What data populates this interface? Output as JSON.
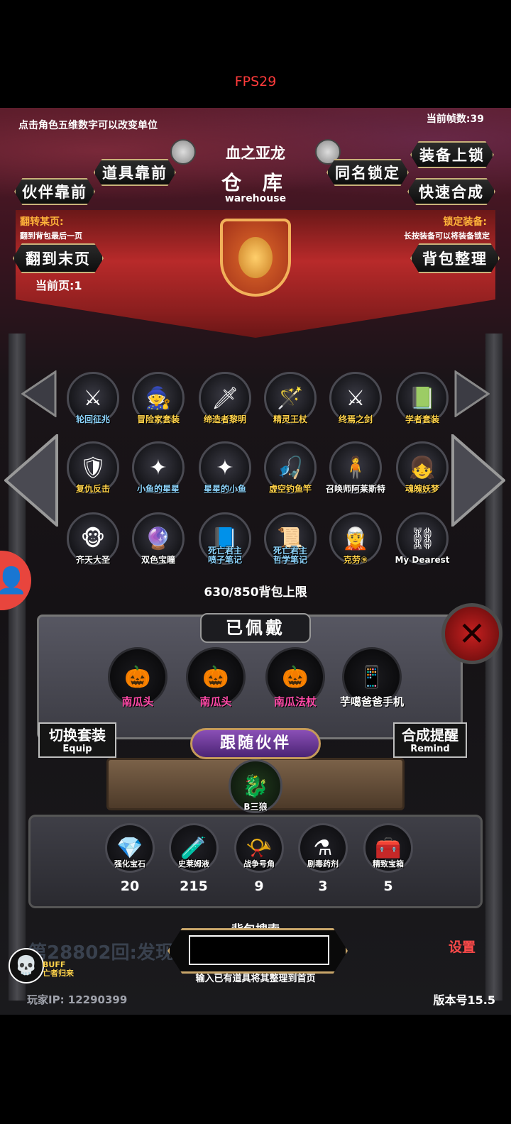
{
  "fps": "FPS29",
  "hud": {
    "hint": "点击角色五维数字可以改变单位",
    "frames": "当前帧数:39"
  },
  "header": {
    "title": "血之亚龙",
    "main": "仓 库",
    "sub": "warehouse"
  },
  "buttons": {
    "items_front": "道具靠前",
    "partner_front": "伙伴靠前",
    "same_lock": "同名锁定",
    "equip_lock": "装备上锁",
    "quick_merge": "快速合成",
    "last_page": "翻到末页",
    "bag_sort": "背包整理",
    "switch_set": "切换套装",
    "switch_set_en": "Equip",
    "merge_remind": "合成提醒",
    "merge_remind_en": "Remind",
    "follow_partner": "跟随伙伴"
  },
  "info": {
    "flip_title": "翻转某页:",
    "flip_desc": "翻到背包最后一页",
    "lock_title": "锁定装备:",
    "lock_desc": "长按装备可以将装备锁定",
    "current_page": "当前页:1"
  },
  "inventory": {
    "items": [
      {
        "label": "轮回征兆",
        "icon": "⚔"
      },
      {
        "label": "冒险家套装",
        "icon": "🧙"
      },
      {
        "label": "缔造者黎明",
        "icon": "🗡"
      },
      {
        "label": "精灵王杖",
        "icon": "🪄"
      },
      {
        "label": "终焉之剑",
        "icon": "⚔"
      },
      {
        "label": "学者套装",
        "icon": "📗"
      },
      {
        "label": "复仇反击",
        "icon": "🛡"
      },
      {
        "label": "小鱼的星星",
        "icon": "✦"
      },
      {
        "label": "星星的小鱼",
        "icon": "✦"
      },
      {
        "label": "虚空钓鱼竿",
        "icon": "🎣"
      },
      {
        "label": "召唤师阿莱斯特",
        "icon": "🧍"
      },
      {
        "label": "魂魄妖梦",
        "icon": "👧"
      },
      {
        "label": "齐天大圣",
        "icon": "🐵"
      },
      {
        "label": "双色宝瞳",
        "icon": "🔮"
      },
      {
        "label": "死亡君主\n喷子笔记",
        "icon": "📘"
      },
      {
        "label": "死亡君主\n哲学笔记",
        "icon": "📜"
      },
      {
        "label": "克劳⑨",
        "icon": "🧝"
      },
      {
        "label": "My Dearest",
        "icon": "⛓"
      }
    ],
    "capacity": "630/850背包上限"
  },
  "worn": {
    "title": "已佩戴",
    "items": [
      {
        "label": "南瓜头",
        "icon": "🎃"
      },
      {
        "label": "南瓜头",
        "icon": "🎃"
      },
      {
        "label": "南瓜法杖",
        "icon": "🎃"
      },
      {
        "label": "芋噶爸爸手机",
        "icon": "📱"
      }
    ]
  },
  "pet": {
    "label": "B三狼",
    "icon": "🐉"
  },
  "resources": [
    {
      "label": "强化宝石",
      "count": "20",
      "icon": "💎"
    },
    {
      "label": "史莱姆液",
      "count": "215",
      "icon": "🧪"
    },
    {
      "label": "战争号角",
      "count": "9",
      "icon": "📯"
    },
    {
      "label": "剧毒药剂",
      "count": "3",
      "icon": "⚗"
    },
    {
      "label": "精致宝箱",
      "count": "5",
      "icon": "🧰"
    }
  ],
  "search": {
    "title": "背包搜索",
    "hint": "输入已有道具将其整理到首页"
  },
  "footer": {
    "round": "第28802回:发现泸",
    "player_ip": "玩家IP:  12290399",
    "version": "版本号15.5",
    "buff": "BUFF",
    "buff_sub": "亡者归来",
    "settings": "设置"
  },
  "colors": {
    "accent_red": "#b82a2a",
    "label_yellow": "#ffd24a",
    "label_pink": "#ff4aa8",
    "fps_red": "#ff3b3b"
  }
}
